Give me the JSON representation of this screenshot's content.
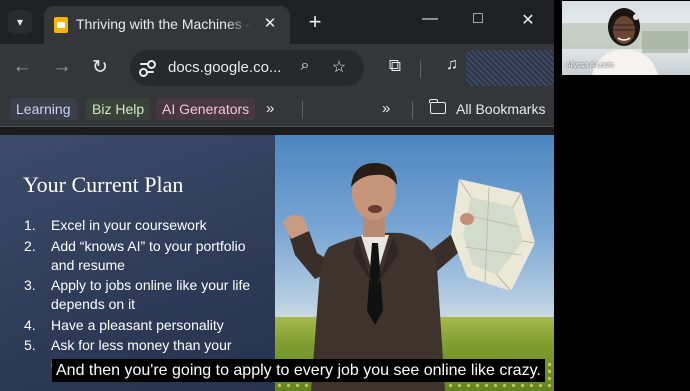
{
  "browser": {
    "tab": {
      "title": "Thriving with the Machines - Google Docs"
    },
    "address_bar": {
      "url": "docs.google.co..."
    },
    "bookmarks": {
      "items": [
        {
          "label": "Learning"
        },
        {
          "label": "Biz Help"
        },
        {
          "label": "AI Generators"
        }
      ],
      "overflow_label": "»",
      "all_bookmarks_label": "All Bookmarks"
    },
    "icons": {
      "tab_dropdown": "chevron-down-icon",
      "new_tab": "plus-icon",
      "minimize": "minimize-icon",
      "maximize": "maximize-icon",
      "close": "close-icon",
      "back": "arrow-left-icon",
      "forward": "arrow-right-icon",
      "reload": "reload-icon",
      "zoom": "zoom-out-icon",
      "bookmark_star": "star-icon",
      "extensions": "puzzle-icon",
      "media": "media-control-icon",
      "folder": "folder-icon"
    }
  },
  "slide": {
    "title": "Your Current Plan",
    "items": [
      {
        "number": "1.",
        "text": "Excel in your coursework"
      },
      {
        "number": "2.",
        "text": "Add “knows AI” to your portfolio and resume"
      },
      {
        "number": "3.",
        "text": "Apply to jobs online like your life depends on it"
      },
      {
        "number": "4.",
        "text": "Have a pleasant personality"
      },
      {
        "number": "5.",
        "text": "Ask for less money than your competition"
      }
    ]
  },
  "caption": "And then you're going to apply to every job you see online like crazy.",
  "video_call": {
    "participant_name": "Allyssa A Lewis"
  },
  "colors": {
    "slide_background": "#2e3c59",
    "browser_toolbar": "#35363a",
    "tab_strip": "#202124"
  }
}
